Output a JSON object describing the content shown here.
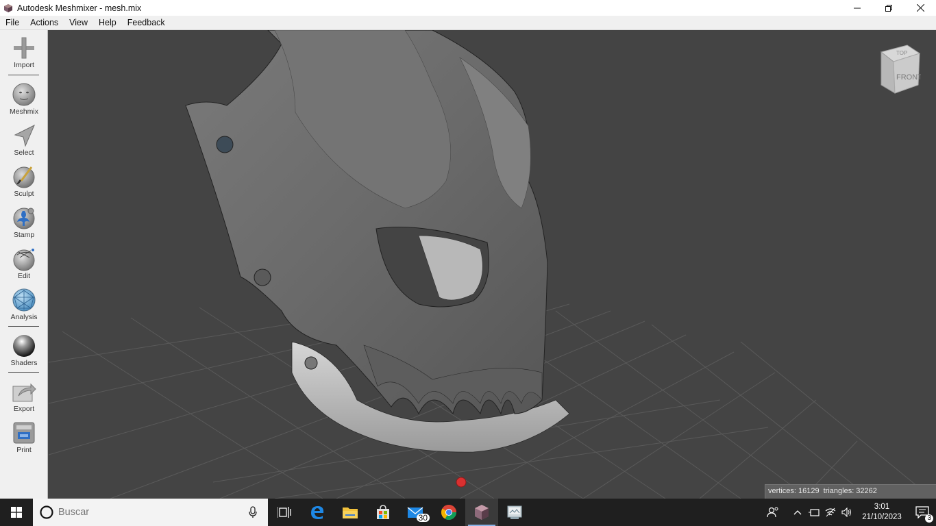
{
  "window": {
    "title": "Autodesk Meshmixer - mesh.mix"
  },
  "menu": [
    "File",
    "Actions",
    "View",
    "Help",
    "Feedback"
  ],
  "tools": {
    "import": "Import",
    "meshmix": "Meshmix",
    "select": "Select",
    "sculpt": "Sculpt",
    "stamp": "Stamp",
    "edit": "Edit",
    "analysis": "Analysis",
    "shaders": "Shaders",
    "export": "Export",
    "print": "Print"
  },
  "viewcube": {
    "top": "TOP",
    "front": "FRONT"
  },
  "stats": {
    "vertices_label": "vertices:",
    "vertices": "16129",
    "triangles_label": "triangles:",
    "triangles": "32262"
  },
  "taskbar": {
    "search_placeholder": "Buscar",
    "mail_badge": "30",
    "time": "3:01",
    "date": "21/10/2023",
    "notifications_badge": "3"
  },
  "colors": {
    "viewport_bg": "#444444",
    "toolbar_bg": "#f0f0f0",
    "taskbar_bg": "#1f1f1f",
    "model_gray": "#6e6e6e",
    "model_light": "#bdbdbd",
    "pivot_red": "#d93030"
  }
}
